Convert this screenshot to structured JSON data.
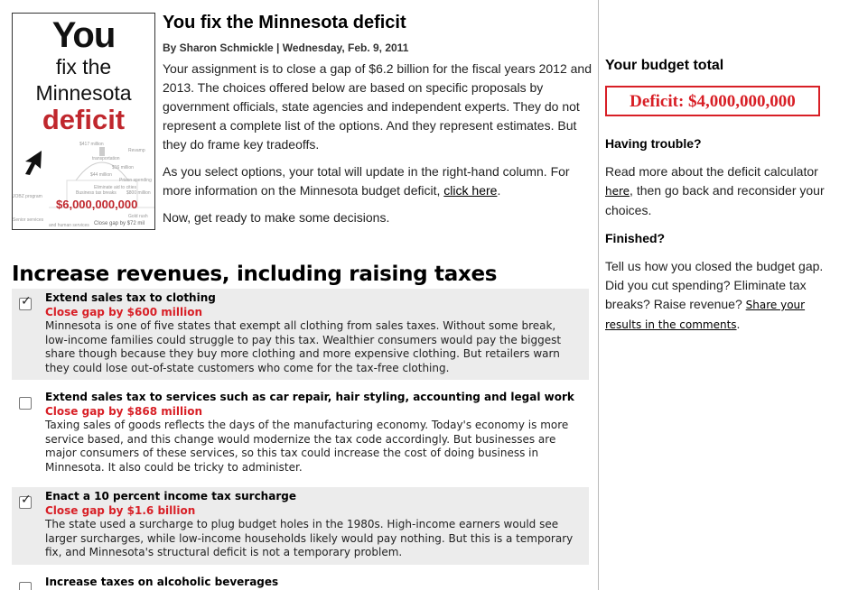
{
  "promo": {
    "line1": "You",
    "line2": "fix the",
    "line3": "Minnesota",
    "line4": "deficit",
    "amount": "$6,000,000,000",
    "close_gap": "Close gap by $72 mil",
    "faint_texts": [
      "$417 million",
      "Revamp",
      "transportation",
      "$16 million",
      "$44 million",
      "Prison spending",
      "Eliminate aid to cities",
      "JOBZ program",
      "Gold rush",
      "Senior services",
      "Business tax breaks",
      "$800 million",
      "and human services"
    ]
  },
  "article": {
    "title": "You fix the Minnesota deficit",
    "byline": "By Sharon Schmickle | Wednesday, Feb. 9, 2011",
    "para1": "Your assignment is to close a gap of $6.2 billion for the fiscal years 2012 and 2013. The choices offered below are based on specific proposals by government officials, state agencies and independent experts. They do not represent a complete list of the options. And they represent estimates. But they do frame key tradeoffs.",
    "para2_pre": "As you select options, your total will update in the right-hand column. For more information on the Minnesota budget deficit, ",
    "para2_link": "click here",
    "para2_post": ".",
    "para3": "Now, get ready to make some decisions."
  },
  "sidebar": {
    "heading": "Your budget total",
    "deficit": "Deficit: $4,000,000,000",
    "trouble_heading": "Having trouble?",
    "trouble_pre": "Read more about the deficit calculator ",
    "trouble_link": "here",
    "trouble_post": ", then go back and reconsider your choices.",
    "finished_heading": "Finished?",
    "finished_pre": "Tell us how you closed the budget gap. Did you cut spending? Eliminate tax breaks? Raise revenue? ",
    "finished_link": "Share your results in the comments",
    "finished_post": "."
  },
  "section": {
    "title": "Increase revenues, including raising taxes",
    "options": [
      {
        "checked": true,
        "name": "Extend sales tax to clothing",
        "gap": "Close gap by $600 million",
        "desc": "Minnesota is one of five states that exempt all clothing from sales taxes. Without some break, low-income families could struggle to pay this tax. Wealthier consumers would pay the biggest share though because they buy more clothing and more expensive clothing. But retailers warn they could lose out-of-state customers who come for the tax-free clothing."
      },
      {
        "checked": false,
        "name": "Extend sales tax to services such as car repair, hair styling, accounting and legal work",
        "gap": "Close gap by $868 million",
        "desc": "Taxing sales of goods reflects the days of the manufacturing economy. Today's economy is more service based, and this change would modernize the tax code accordingly. But businesses are major consumers of these services, so this tax could increase the cost of doing business in Minnesota. It also could be tricky to administer."
      },
      {
        "checked": true,
        "name": "Enact a 10 percent income tax surcharge",
        "gap": "Close gap by $1.6 billion",
        "desc": "The state used a surcharge to plug budget holes in the 1980s. High-income earners would see larger surcharges, while low-income households likely would pay nothing. But this is a temporary fix, and Minnesota's structural deficit is not a temporary problem."
      },
      {
        "checked": false,
        "name": "Increase taxes on alcoholic beverages",
        "gap": "",
        "desc": ""
      }
    ]
  }
}
